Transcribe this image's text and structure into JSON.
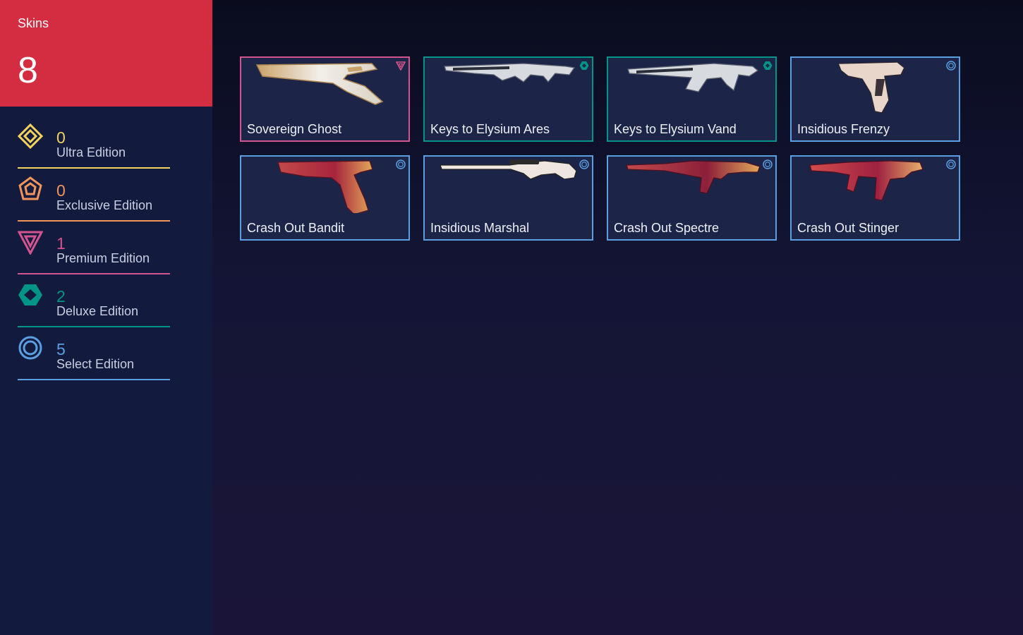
{
  "summary": {
    "label": "Skins",
    "total": "8"
  },
  "tiers": [
    {
      "count": "0",
      "name": "Ultra Edition",
      "color": "#f3d35c",
      "icon": "ultra-edition-icon"
    },
    {
      "count": "0",
      "name": "Exclusive Edition",
      "color": "#f1955b",
      "icon": "exclusive-edition-icon"
    },
    {
      "count": "1",
      "name": "Premium Edition",
      "color": "#d2548e",
      "icon": "premium-edition-icon"
    },
    {
      "count": "2",
      "name": "Deluxe Edition",
      "color": "#009587",
      "icon": "deluxe-edition-icon"
    },
    {
      "count": "5",
      "name": "Select Edition",
      "color": "#5a9fe2",
      "icon": "select-edition-icon"
    }
  ],
  "skins": [
    {
      "name": "Sovereign Ghost",
      "tier": "premium",
      "color": "#d2548e",
      "weapon": "pistol-icon"
    },
    {
      "name": "Keys to Elysium Ares",
      "tier": "deluxe",
      "color": "#009587",
      "weapon": "rifle-icon"
    },
    {
      "name": "Keys to Elysium Vand",
      "tier": "deluxe",
      "color": "#009587",
      "weapon": "rifle-icon"
    },
    {
      "name": "Insidious Frenzy",
      "tier": "select",
      "color": "#5a9fe2",
      "weapon": "machine-pistol-icon"
    },
    {
      "name": "Crash Out Bandit",
      "tier": "select",
      "color": "#5a9fe2",
      "weapon": "pistol-icon"
    },
    {
      "name": "Insidious Marshal",
      "tier": "select",
      "color": "#5a9fe2",
      "weapon": "sniper-icon"
    },
    {
      "name": "Crash Out Spectre",
      "tier": "select",
      "color": "#5a9fe2",
      "weapon": "smg-icon"
    },
    {
      "name": "Crash Out Stinger",
      "tier": "select",
      "color": "#5a9fe2",
      "weapon": "smg-icon"
    }
  ]
}
